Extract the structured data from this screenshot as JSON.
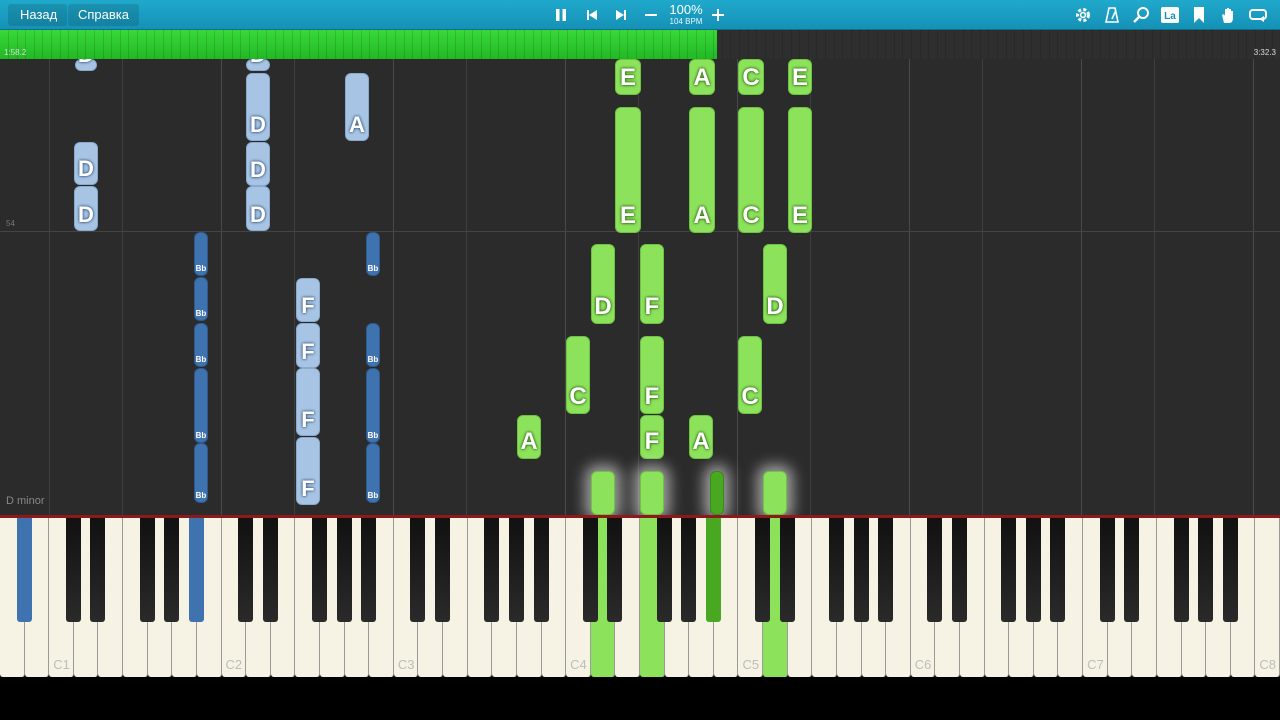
{
  "toolbar": {
    "back_label": "Назад",
    "help_label": "Справка",
    "tempo_percent": "100%",
    "tempo_bpm": "104 BPM",
    "icons": [
      "pause-icon",
      "skip-back-icon",
      "skip-forward-icon",
      "minus-icon",
      "plus-icon",
      "gear-icon",
      "metronome-icon",
      "zoom-icon",
      "note-label-icon",
      "bookmark-icon",
      "hand-icon",
      "loop-icon"
    ]
  },
  "progress": {
    "current_time": "1:58.2",
    "total_time": "3:32.3",
    "fraction": 0.56
  },
  "roll": {
    "measure_number": "54",
    "key_signature": "D minor"
  },
  "notes": [
    {
      "label": "D",
      "style": "lb"
    },
    {
      "label": "D",
      "style": "lb"
    },
    {
      "label": "D",
      "style": "lb"
    },
    {
      "label": "D",
      "style": "lb"
    },
    {
      "label": "D",
      "style": "lb"
    },
    {
      "label": "D",
      "style": "lb"
    },
    {
      "label": "D",
      "style": "lb"
    },
    {
      "label": "A",
      "style": "lb"
    },
    {
      "label": "Bb",
      "style": "db"
    },
    {
      "label": "Bb",
      "style": "db"
    },
    {
      "label": "Bb",
      "style": "db"
    },
    {
      "label": "Bb",
      "style": "db"
    },
    {
      "label": "Bb",
      "style": "db"
    },
    {
      "label": "F",
      "style": "lb"
    },
    {
      "label": "F",
      "style": "lb"
    },
    {
      "label": "F",
      "style": "lb"
    },
    {
      "label": "F",
      "style": "lb"
    },
    {
      "label": "Bb",
      "style": "db"
    },
    {
      "label": "Bb",
      "style": "db"
    },
    {
      "label": "Bb",
      "style": "db"
    },
    {
      "label": "Bb",
      "style": "db"
    },
    {
      "label": "E",
      "style": "gr"
    },
    {
      "label": "E",
      "style": "gr"
    },
    {
      "label": "A",
      "style": "gr"
    },
    {
      "label": "A",
      "style": "gr"
    },
    {
      "label": "C",
      "style": "gr"
    },
    {
      "label": "C",
      "style": "gr"
    },
    {
      "label": "E",
      "style": "gr"
    },
    {
      "label": "E",
      "style": "gr"
    },
    {
      "label": "D",
      "style": "gr"
    },
    {
      "label": "F",
      "style": "gr"
    },
    {
      "label": "D",
      "style": "gr"
    },
    {
      "label": "C",
      "style": "gr"
    },
    {
      "label": "F",
      "style": "gr"
    },
    {
      "label": "C",
      "style": "gr"
    },
    {
      "label": "A",
      "style": "gr"
    },
    {
      "label": "F",
      "style": "gr"
    },
    {
      "label": "A",
      "style": "gr"
    },
    {
      "label": "",
      "style": "gr"
    },
    {
      "label": "",
      "style": "gr"
    },
    {
      "label": "",
      "style": "gd"
    },
    {
      "label": "",
      "style": "gr"
    }
  ],
  "keyboard": {
    "octave_labels": [
      "C1",
      "C2",
      "C3",
      "C4",
      "C5",
      "C6",
      "C7",
      "C8"
    ],
    "highlight_colors": {
      "left_hand": "#3f73b0",
      "right_hand": "#8de25c",
      "right_hand_dark": "#49a821"
    }
  }
}
